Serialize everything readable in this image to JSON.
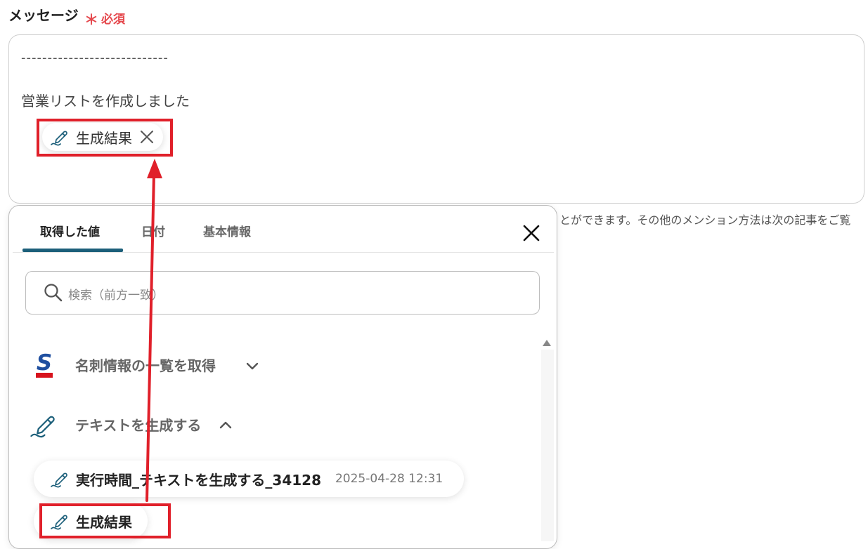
{
  "field": {
    "label": "メッセージ",
    "required_mark": "＊",
    "required_text": "必須"
  },
  "message": {
    "separator": "----------------------------",
    "line": "営業リストを作成しました",
    "chip_label": "生成結果"
  },
  "hint": "とができます。その他のメンション方法は次の記事をご覧",
  "picker": {
    "tabs": [
      {
        "label": "取得した値",
        "active": true
      },
      {
        "label": "日付",
        "active": false
      },
      {
        "label": "基本情報",
        "active": false
      }
    ],
    "search_placeholder": "検索（前方一致）",
    "groups": [
      {
        "label": "名刺情報の一覧を取得",
        "icon": "sansan-logo-icon",
        "expanded": false
      },
      {
        "label": "テキストを生成する",
        "icon": "pen-icon",
        "expanded": true
      }
    ],
    "items": [
      {
        "name": "実行時間_テキストを生成する_34128",
        "time": "2025-04-28 12:31"
      },
      {
        "name": "生成結果",
        "time": ""
      }
    ]
  },
  "colors": {
    "accent": "#1c5f7a",
    "highlight": "#e0202a",
    "required": "#e5484d",
    "sansan_blue": "#1f4fa0",
    "sansan_red": "#d7131d"
  }
}
